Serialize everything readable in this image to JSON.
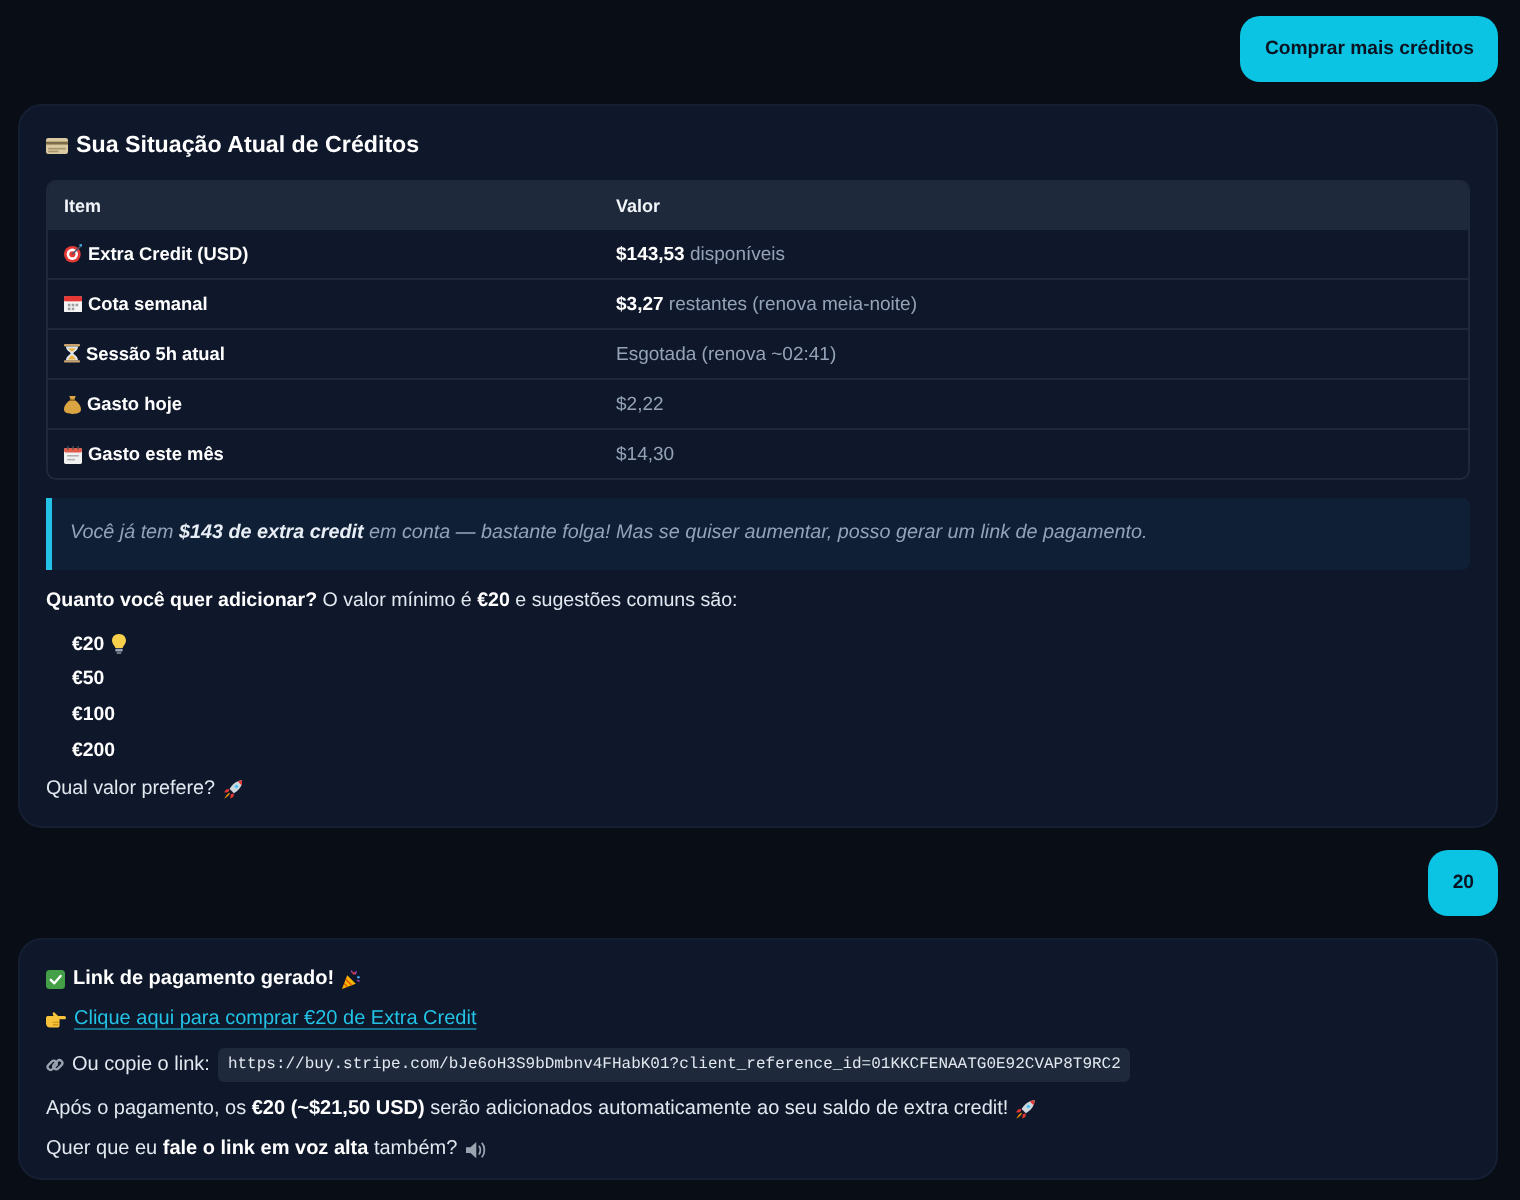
{
  "conversation": [
    {
      "kind": "user",
      "text": "Comprar mais créditos"
    },
    {
      "kind": "credits_summary",
      "title": "Sua Situação Atual de Créditos",
      "table": {
        "columns": [
          "Item",
          "Valor"
        ],
        "rows": [
          {
            "item": "Extra Credit (USD)",
            "value": "**$143,53** disponíveis"
          },
          {
            "item": "Cota semanal",
            "value": "**$3,27** restantes (renova meia-noite)"
          },
          {
            "item": "Sessão 5h atual",
            "value": "Esgotada (renova ~02:41)"
          },
          {
            "item": "Gasto hoje",
            "value": "$2,22"
          },
          {
            "item": "Gasto este mês",
            "value": "$14,30"
          }
        ]
      },
      "note": "Você já tem **$143 de extra credit** em conta — bastante folga! Mas se quiser aumentar, posso gerar um link de pagamento.",
      "question": "**Quanto você quer adicionar?** O valor mínimo é **€20** e sugestões comuns são:",
      "options": [
        {
          "label": "€20",
          "suggested": true
        },
        {
          "label": "€50",
          "suggested": false
        },
        {
          "label": "€100",
          "suggested": false
        },
        {
          "label": "€200",
          "suggested": false
        }
      ],
      "closing": "Qual valor prefere?"
    },
    {
      "kind": "user",
      "text": "20"
    },
    {
      "kind": "payment_link",
      "heading": "Link de pagamento gerado!",
      "link": "Clique aqui para comprar €20 de Extra Credit",
      "copy_label": "Ou copie o link:",
      "url": "https://buy.stripe.com/bJe6oH3S9bDmbnv4FHabK01?client_reference_id=01KKCFENAATG0E92CVAP8T9RC2",
      "confirmation": "Após o pagamento, os **€20 (~$21,50 USD)** serão adicionados automaticamente ao seu saldo de extra credit!",
      "closing": "Quer que eu **fale o link em voz alta** também?"
    }
  ]
}
